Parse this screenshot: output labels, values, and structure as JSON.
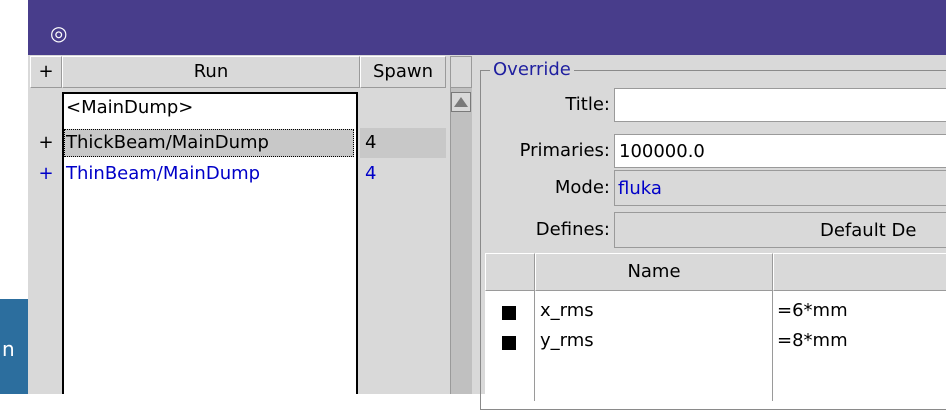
{
  "background": {
    "tab_fragment": "n"
  },
  "window": {
    "title_icon": "target-icon"
  },
  "runs_table": {
    "headers": {
      "plus": "+",
      "run": "Run",
      "spawn": "Spawn"
    },
    "rows": [
      {
        "plus": "",
        "run": "<MainDump>",
        "spawn": ""
      },
      {
        "plus": "+",
        "run": "ThickBeam/MainDump",
        "spawn": "4"
      },
      {
        "plus": "+",
        "run": "ThinBeam/MainDump",
        "spawn": "4"
      }
    ]
  },
  "override": {
    "group_title": "Override",
    "title_label": "Title:",
    "title_value": "",
    "primaries_label": "Primaries:",
    "primaries_value": "100000.0",
    "mode_label": "Mode:",
    "mode_value": "fluka",
    "defines_label": "Defines:",
    "defines_button": "Default De",
    "defines_table": {
      "headers": [
        "",
        "Name",
        ""
      ],
      "rows": [
        {
          "name": "x_rms",
          "value": "=6*mm"
        },
        {
          "name": "y_rms",
          "value": "=8*mm"
        }
      ]
    }
  },
  "colors": {
    "titlebar": "#483d8b",
    "selected_row": "#c8c8c8",
    "link_blue": "#0000c8"
  }
}
